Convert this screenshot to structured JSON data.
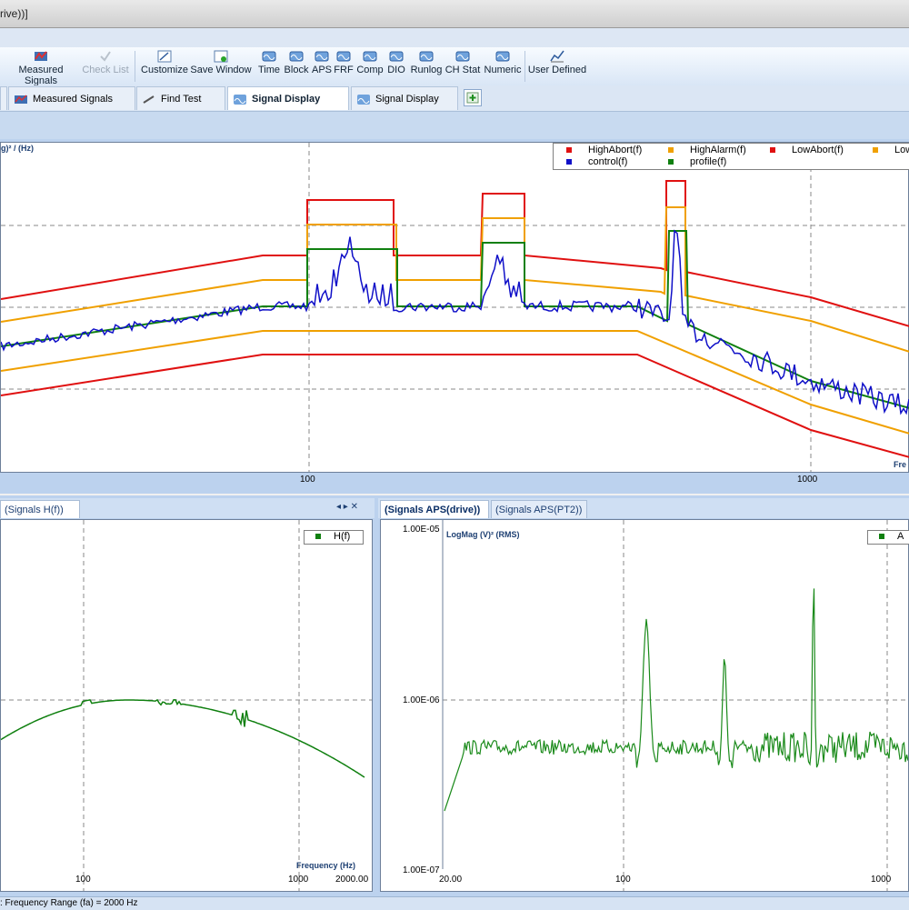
{
  "window": {
    "title_fragment": "rive))]"
  },
  "ribbon": {
    "items": [
      {
        "label": "Measured Signals",
        "icon": "measured-signals-icon",
        "enabled": true
      },
      {
        "label": "Check List",
        "icon": "check-list-icon",
        "enabled": false
      },
      {
        "label": "Customize",
        "icon": "customize-icon",
        "enabled": true
      },
      {
        "label": "Save Window",
        "icon": "save-window-icon",
        "enabled": true
      },
      {
        "label": "Time",
        "icon": "time-icon",
        "enabled": true
      },
      {
        "label": "Block",
        "icon": "block-icon",
        "enabled": true
      },
      {
        "label": "APS",
        "icon": "aps-icon",
        "enabled": true
      },
      {
        "label": "FRF",
        "icon": "frf-icon",
        "enabled": true
      },
      {
        "label": "Comp",
        "icon": "comp-icon",
        "enabled": true
      },
      {
        "label": "DIO",
        "icon": "dio-icon",
        "enabled": true
      },
      {
        "label": "Runlog",
        "icon": "runlog-icon",
        "enabled": true
      },
      {
        "label": "CH Stat",
        "icon": "ch-stat-icon",
        "enabled": true
      },
      {
        "label": "Numeric",
        "icon": "numeric-icon",
        "enabled": true
      },
      {
        "label": "User Defined",
        "icon": "user-defined-icon",
        "enabled": true
      }
    ]
  },
  "tabs": [
    {
      "label": "Measured Signals",
      "active": false
    },
    {
      "label": "Find Test",
      "active": false
    },
    {
      "label": "Signal Display",
      "active": true
    },
    {
      "label": "Signal Display",
      "active": false
    }
  ],
  "top_plot": {
    "ylabel_fragment": "g)² / (Hz)",
    "xlabel_fragment": "Fre",
    "x_ticks": [
      "100",
      "1000"
    ],
    "legend": [
      {
        "name": "HighAbort(f)",
        "color": "#e01010"
      },
      {
        "name": "HighAlarm(f)",
        "color": "#f0a000"
      },
      {
        "name": "LowAbort(f)",
        "color": "#e01010"
      },
      {
        "name": "Low",
        "color": "#f0a000"
      },
      {
        "name": "control(f)",
        "color": "#1010c8"
      },
      {
        "name": "profile(f)",
        "color": "#108010"
      }
    ]
  },
  "left_panel": {
    "tab_label": "(Signals H(f))",
    "tab_controls": "◂ ▸ ✕",
    "legend_name": "H(f)",
    "xlabel": "Frequency (Hz)",
    "x_ticks": [
      "100",
      "1000",
      "2000.00"
    ]
  },
  "right_panel": {
    "tabs": [
      "(Signals APS(drive))",
      "(Signals APS(PT2))"
    ],
    "ylabel": "LogMag (V)² (RMS)",
    "legend_name": "A",
    "y_ticks": [
      "1.00E-05",
      "1.00E-06",
      "1.00E-07"
    ],
    "x_ticks": [
      "20.00",
      "100",
      "1000"
    ]
  },
  "status": {
    "text": ": Frequency Range (fa) = 2000 Hz"
  },
  "colors": {
    "abort": "#e01010",
    "alarm": "#f0a000",
    "control": "#1010c8",
    "profile": "#108010",
    "green_trace": "#1a8a1a"
  }
}
